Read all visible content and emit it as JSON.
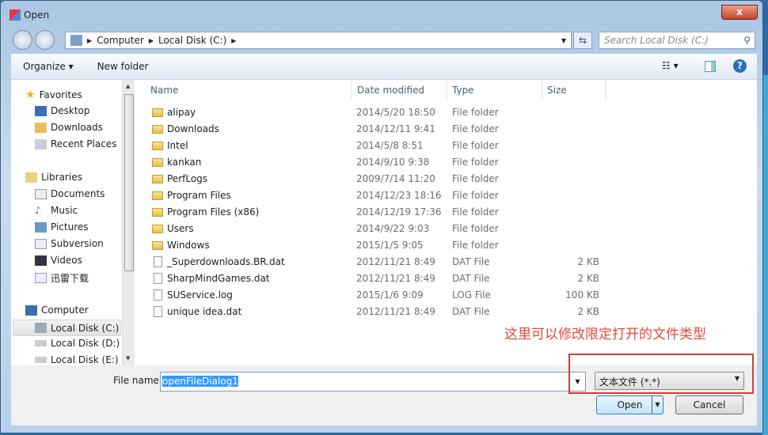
{
  "window": {
    "title": "Open",
    "close": "x"
  },
  "address": {
    "crumbs": [
      "Computer",
      "Local Disk (C:)"
    ],
    "search_placeholder": "Search Local Disk (C:)"
  },
  "toolbar": {
    "organize": "Organize ▾",
    "new_folder": "New folder"
  },
  "nav": {
    "favorites": "Favorites",
    "desktop": "Desktop",
    "downloads": "Downloads",
    "recent": "Recent Places",
    "libraries": "Libraries",
    "documents": "Documents",
    "music": "Music",
    "pictures": "Pictures",
    "subversion": "Subversion",
    "videos": "Videos",
    "xunlei": "迅雷下载",
    "computer": "Computer",
    "c": "Local Disk (C:)",
    "d": "Local Disk (D:)",
    "e": "Local Disk (E:)"
  },
  "columns": {
    "name": "Name",
    "date": "Date modified",
    "type": "Type",
    "size": "Size"
  },
  "files": [
    {
      "name": "alipay",
      "date": "2014/5/20 18:50",
      "type": "File folder",
      "size": ""
    },
    {
      "name": "Downloads",
      "date": "2014/12/11 9:41",
      "type": "File folder",
      "size": ""
    },
    {
      "name": "Intel",
      "date": "2014/5/8 8:51",
      "type": "File folder",
      "size": ""
    },
    {
      "name": "kankan",
      "date": "2014/9/10 9:38",
      "type": "File folder",
      "size": ""
    },
    {
      "name": "PerfLogs",
      "date": "2009/7/14 11:20",
      "type": "File folder",
      "size": ""
    },
    {
      "name": "Program Files",
      "date": "2014/12/23 18:16",
      "type": "File folder",
      "size": ""
    },
    {
      "name": "Program Files (x86)",
      "date": "2014/12/19 17:36",
      "type": "File folder",
      "size": ""
    },
    {
      "name": "Users",
      "date": "2014/9/22 9:03",
      "type": "File folder",
      "size": ""
    },
    {
      "name": "Windows",
      "date": "2015/1/5 9:05",
      "type": "File folder",
      "size": ""
    },
    {
      "name": "_Superdownloads.BR.dat",
      "date": "2012/11/21 8:49",
      "type": "DAT File",
      "size": "2 KB"
    },
    {
      "name": "SharpMindGames.dat",
      "date": "2012/11/21 8:49",
      "type": "DAT File",
      "size": "2 KB"
    },
    {
      "name": "SUService.log",
      "date": "2015/1/6 9:09",
      "type": "LOG File",
      "size": "100 KB"
    },
    {
      "name": "unique idea.dat",
      "date": "2012/11/21 8:49",
      "type": "DAT File",
      "size": "2 KB"
    }
  ],
  "bottom": {
    "file_name_label": "File name:",
    "file_name_value": "openFileDialog1",
    "filter": "文本文件 (*.*)",
    "open": "Open",
    "cancel": "Cancel"
  },
  "annotation": {
    "text": "这里可以修改限定打开的文件类型",
    "color": "#e04a3a"
  }
}
